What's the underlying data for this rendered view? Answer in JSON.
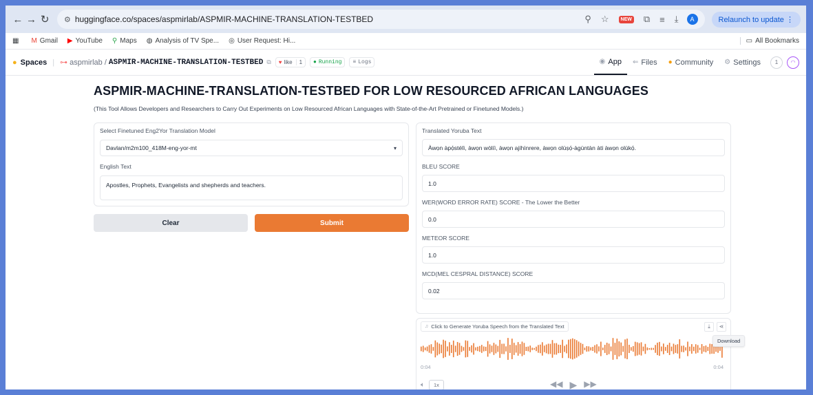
{
  "browser": {
    "url": "huggingface.co/spaces/aspmirlab/ASPMIR-MACHINE-TRANSLATION-TESTBED",
    "relaunch_label": "Relaunch to update",
    "new_badge": "NEW",
    "avatar_letter": "A",
    "bookmarks": [
      "Gmail",
      "YouTube",
      "Maps",
      "Analysis of TV Spe...",
      "User Request: Hi..."
    ],
    "all_bookmarks": "All Bookmarks"
  },
  "hf_header": {
    "spaces_label": "Spaces",
    "owner": "aspmirlab",
    "repo": "ASPMIR-MACHINE-TRANSLATION-TESTBED",
    "like_label": "like",
    "like_count": "1",
    "running_label": "Running",
    "logs_label": "Logs",
    "tabs": [
      "App",
      "Files",
      "Community",
      "Settings"
    ],
    "badge_count": "1"
  },
  "page": {
    "title": "ASPMIR-MACHINE-TRANSLATION-TESTBED FOR LOW RESOURCED AFRICAN LANGUAGES",
    "subtitle": "(This Tool Allows Developers and Researchers to Carry Out Experiments on Low Resourced African Languages with State-of-the-Art Pretrained or Finetuned Models.)"
  },
  "form": {
    "model_label": "Select Finetuned Eng2Yor Translation Model",
    "model_value": "Davlan/m2m100_418M-eng-yor-mt",
    "english_label": "English Text",
    "english_value": "Apostles, Prophets, Evangelists and shepherds and teachers.",
    "clear_label": "Clear",
    "submit_label": "Submit"
  },
  "outputs": {
    "translated_label": "Translated Yoruba Text",
    "translated_value": "Àwọn àpọ́stélì, àwọn wòlíì, àwọn ajíhìnrere, àwọn olùṣọ́-àgùntàn àti àwọn olùkọ́.",
    "bleu_label": "BLEU SCORE",
    "bleu_value": "1.0",
    "wer_label": "WER(WORD ERROR RATE) SCORE - The Lower the Better",
    "wer_value": "0.0",
    "meteor_label": "METEOR SCORE",
    "meteor_value": "1.0",
    "mcd_label": "MCD(MEL CESPRAL DISTANCE) SCORE",
    "mcd_value": "0.02"
  },
  "audio": {
    "label": "Click to Generate Yoruba Speech from the Translated Text",
    "tooltip": "Download",
    "time_start": "0:04",
    "time_end": "0:04",
    "speed": "1x",
    "wave_color": "#ea7a33"
  }
}
